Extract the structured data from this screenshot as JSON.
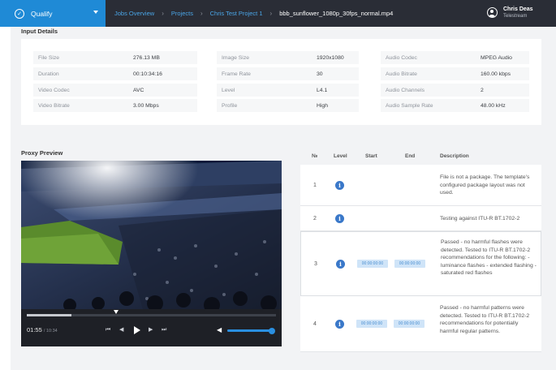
{
  "topbar": {
    "app_menu": "Qualify",
    "breadcrumbs": [
      "Jobs Overview",
      "Projects",
      "Chris Test Project 1",
      "bbb_sunflower_1080p_30fps_normal.mp4"
    ],
    "user_name": "Chris Deas",
    "user_org": "Telestream"
  },
  "input_details": {
    "title": "Input Details",
    "col1": [
      {
        "label": "File Size",
        "value": "276.13 MB"
      },
      {
        "label": "Duration",
        "value": "00:10:34:16"
      },
      {
        "label": "Video Codec",
        "value": "AVC"
      },
      {
        "label": "Video Bitrate",
        "value": "3.00 Mbps"
      }
    ],
    "col2": [
      {
        "label": "Image Size",
        "value": "1920x1080"
      },
      {
        "label": "Frame Rate",
        "value": "30"
      },
      {
        "label": "Level",
        "value": "L4.1"
      },
      {
        "label": "Profile",
        "value": "High"
      }
    ],
    "col3": [
      {
        "label": "Audio Codec",
        "value": "MPEG Audio"
      },
      {
        "label": "Audio Bitrate",
        "value": "160.00 kbps"
      },
      {
        "label": "Audio Channels",
        "value": "2"
      },
      {
        "label": "Audio Sample Rate",
        "value": "48.00 kHz"
      }
    ]
  },
  "proxy": {
    "title": "Proxy Preview",
    "current_time": "01:55",
    "duration": "/ 10:34",
    "progress_fraction": 0.18,
    "volume_fraction": 0.95
  },
  "results": {
    "headers": {
      "no": "№",
      "level": "Level",
      "start": "Start",
      "end": "End",
      "description": "Description"
    },
    "rows": [
      {
        "no": "1",
        "start": "",
        "end": "",
        "description": "File is not a package. The template's configured package layout was not used."
      },
      {
        "no": "2",
        "start": "",
        "end": "",
        "description": "Testing against ITU-R BT.1702-2"
      },
      {
        "no": "3",
        "start": "00:00:00:00",
        "end": "00:00:00:00",
        "description": "Passed - no harmful flashes were detected. Tested to ITU-R BT.1702-2 recommendations for the following: - luminance flashes - extended flashing - saturated red flashes"
      },
      {
        "no": "4",
        "start": "00:00:00:00",
        "end": "00:00:00:00",
        "description": "Passed - no harmful patterns were detected. Tested to ITU-R BT.1702-2 recommendations for potentially harmful regular patterns."
      }
    ]
  },
  "colors": {
    "accent": "#1f8ad6",
    "topbar": "#2a2d36",
    "info_icon": "#3a78c9",
    "timecode_bg": "#cfe4f8"
  }
}
